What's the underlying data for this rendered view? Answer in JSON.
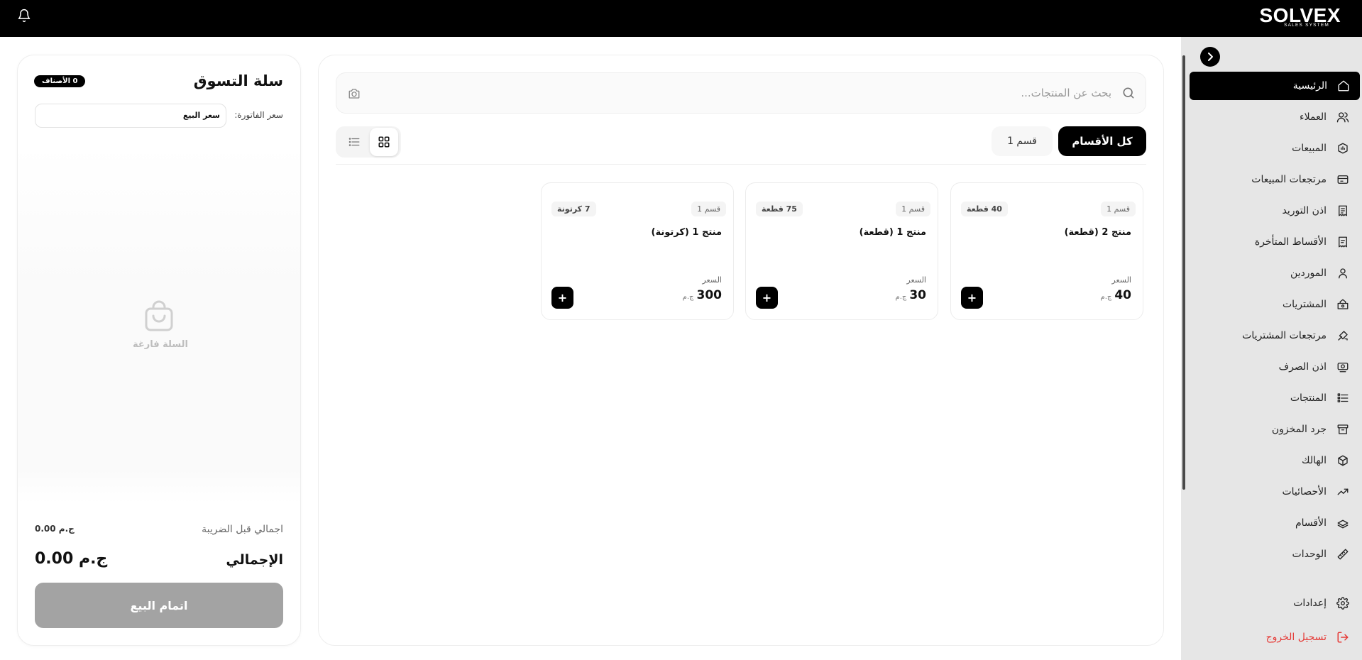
{
  "brand": {
    "name": "SOLVEX",
    "tagline": "SALES SYSTEM"
  },
  "sidebar": {
    "items": [
      {
        "label": "الرئيسية",
        "icon": "home-icon"
      },
      {
        "label": "العملاء",
        "icon": "users-icon"
      },
      {
        "label": "المبيعات",
        "icon": "sales-icon"
      },
      {
        "label": "مرتجعات المبيعات",
        "icon": "sales-return-icon"
      },
      {
        "label": "اذن التوريد",
        "icon": "receipt-icon"
      },
      {
        "label": "الأقساط المتأخرة",
        "icon": "overdue-icon"
      },
      {
        "label": "الموردين",
        "icon": "user-icon"
      },
      {
        "label": "المشتريات",
        "icon": "purchases-icon"
      },
      {
        "label": "مرتجعات المشتريات",
        "icon": "purchase-return-icon"
      },
      {
        "label": "اذن الصرف",
        "icon": "cash-icon"
      },
      {
        "label": "المنتجات",
        "icon": "list-icon"
      },
      {
        "label": "جرد المخزون",
        "icon": "archive-icon"
      },
      {
        "label": "الهالك",
        "icon": "box-icon"
      },
      {
        "label": "الأحصائيات",
        "icon": "trend-icon"
      },
      {
        "label": "الأقسام",
        "icon": "categories-icon"
      },
      {
        "label": "الوحدات",
        "icon": "ruler-icon"
      }
    ],
    "settings": "إعدادات",
    "logout": "تسجيل الخروج"
  },
  "search": {
    "placeholder": "بحث عن المنتجات..."
  },
  "tabs": {
    "all": "كل الأقسام",
    "cat1": "قسم 1"
  },
  "products": [
    {
      "category": "قسم 1",
      "stock": "40 قطعة",
      "name": "منتج 2 (قطعة)",
      "price_label": "السعر",
      "price": "40",
      "currency": "ج.م"
    },
    {
      "category": "قسم 1",
      "stock": "75 قطعة",
      "name": "منتج 1 (قطعة)",
      "price_label": "السعر",
      "price": "30",
      "currency": "ج.م"
    },
    {
      "category": "قسم 1",
      "stock": "7 كرتونة",
      "name": "منتج 1 (كرتونة)",
      "price_label": "السعر",
      "price": "300",
      "currency": "ج.م"
    }
  ],
  "cart": {
    "title": "سلة التسوق",
    "count_badge": "0 الأصناف",
    "invoice_price_label": "سعر الفاتورة:",
    "invoice_price_value": "سعر البيع",
    "empty": "السلة فارغة",
    "subtotal_label": "اجمالي قبل الضريبة",
    "subtotal_value": "0.00 ج.م",
    "total_label": "الإجمالي",
    "total_value": "0.00 ج.م",
    "checkout": "اتمام البيع"
  }
}
